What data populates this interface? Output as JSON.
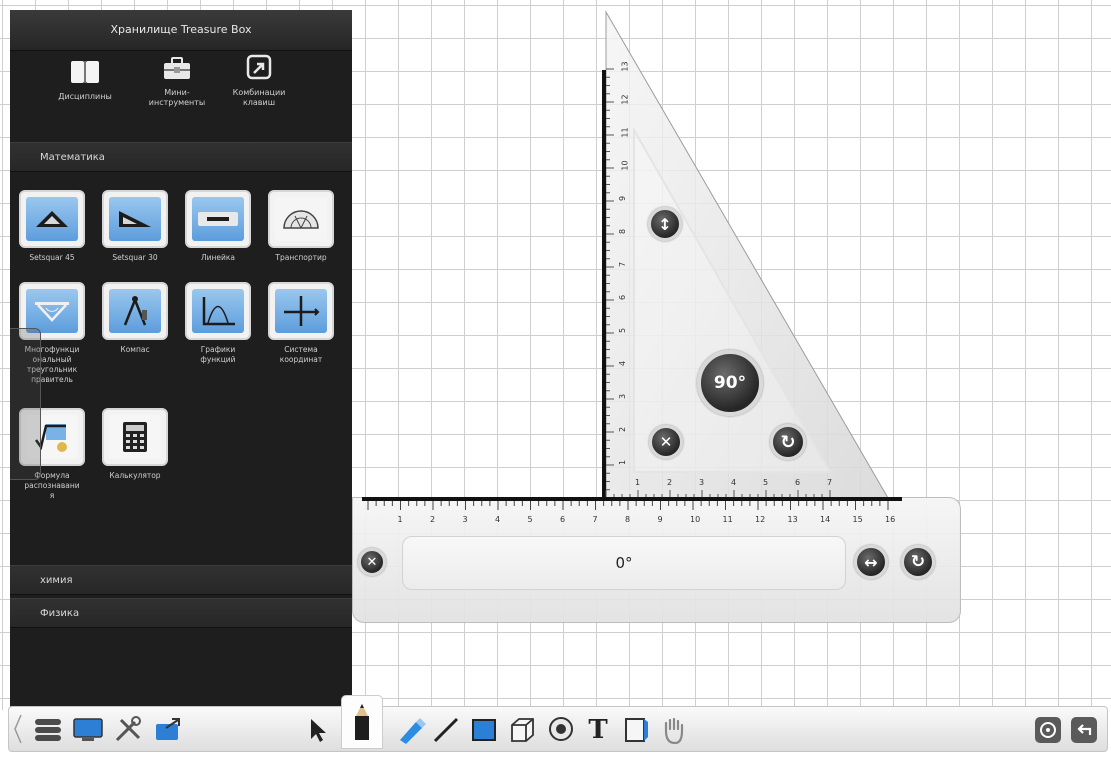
{
  "panel": {
    "title": "Хранилище Treasure Box",
    "tabs": [
      {
        "label": "Дисциплины",
        "icon": "book-icon"
      },
      {
        "label": "Мини-\nинструменты",
        "icon": "toolbox-icon"
      },
      {
        "label": "Комбинации\nклавиш",
        "icon": "shortcut-arrow-icon"
      }
    ],
    "sections": {
      "math": "Математика",
      "chemistry": "химия",
      "physics": "Физика"
    },
    "tools": [
      {
        "label": "Setsquar 45",
        "icon": "setsquare-45-icon"
      },
      {
        "label": "Setsquar 30",
        "icon": "setsquare-30-icon"
      },
      {
        "label": "Линейка",
        "icon": "ruler-icon"
      },
      {
        "label": "Транспортир",
        "icon": "protractor-icon"
      },
      {
        "label": "Многофункци\nональный\nтреугольник\nправитель",
        "icon": "multi-triangle-icon"
      },
      {
        "label": "Компас",
        "icon": "compass-icon"
      },
      {
        "label": "Графики\nфункций",
        "icon": "function-graph-icon"
      },
      {
        "label": "Система\nкоординат",
        "icon": "coordinate-system-icon"
      },
      {
        "label": "Формула\nраспознавани\nя",
        "icon": "formula-icon"
      },
      {
        "label": "Калькулятор",
        "icon": "calculator-icon"
      }
    ]
  },
  "ruler": {
    "angle": "0°",
    "scale_min": 0,
    "scale_max": 16,
    "ticks": [
      "1",
      "2",
      "3",
      "4",
      "5",
      "6",
      "7",
      "8",
      "9",
      "10",
      "11",
      "12",
      "13",
      "14",
      "15",
      "16"
    ]
  },
  "setsquare": {
    "angle": "90°",
    "vertical_ticks": [
      "1",
      "2",
      "3",
      "4",
      "5",
      "6",
      "7",
      "8",
      "9",
      "10",
      "11",
      "12",
      "13"
    ],
    "horizontal_ticks": [
      "1",
      "2",
      "3",
      "4",
      "5",
      "6",
      "7"
    ]
  },
  "toolbar": {
    "items": [
      "menu-icon",
      "display-icon",
      "tools-icon",
      "export-icon",
      "select-arrow-icon",
      "pencil-icon",
      "highlighter-icon",
      "line-icon",
      "rectangle-icon",
      "cube-icon",
      "spotlight-icon",
      "text-icon",
      "page-icon",
      "hand-icon",
      "navigate-icon",
      "undo-icon"
    ]
  }
}
